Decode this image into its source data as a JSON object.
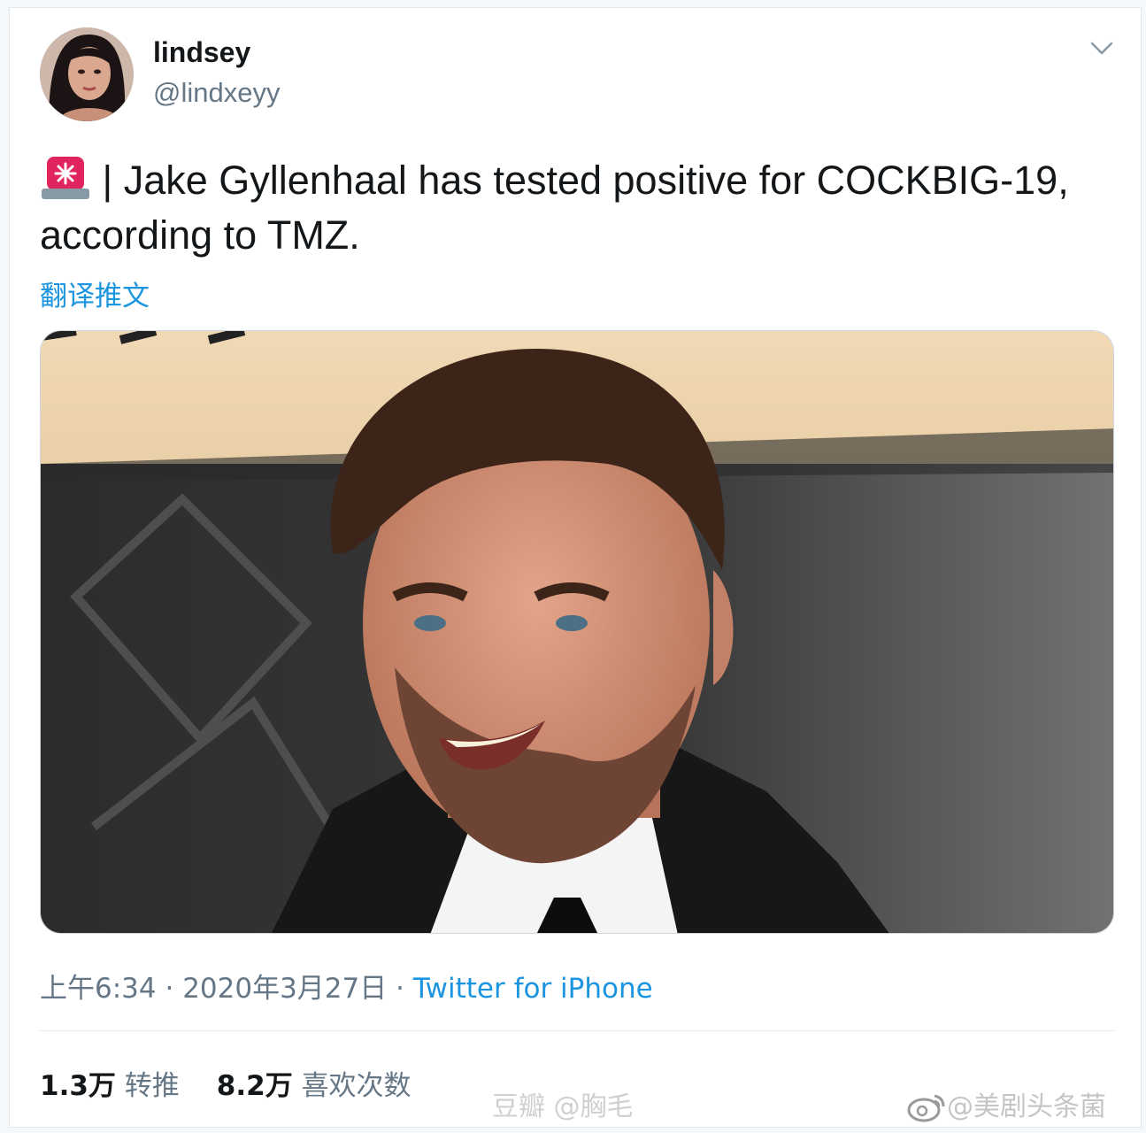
{
  "tweet": {
    "author_name": "lindsey",
    "author_handle": "@lindxeyy",
    "text_icon": "police-siren-icon",
    "text": " | Jake Gyllenhaal has tested positive for COCKBIG-19, according to TMZ.",
    "translate_label": "翻译推文",
    "time": "上午6:34",
    "separator": " · ",
    "date": "2020年3月27日",
    "source": "Twitter for iPhone",
    "retweets_count": "1.3万",
    "retweets_label": "转推",
    "likes_count": "8.2万",
    "likes_label": "喜欢次数"
  },
  "watermarks": {
    "douban": "豆瓣 @胸毛",
    "weibo": "@美剧头条菌"
  },
  "colors": {
    "link": "#1b95e0",
    "text": "#14171a",
    "secondary": "#657786",
    "border": "#e1e8ed"
  }
}
